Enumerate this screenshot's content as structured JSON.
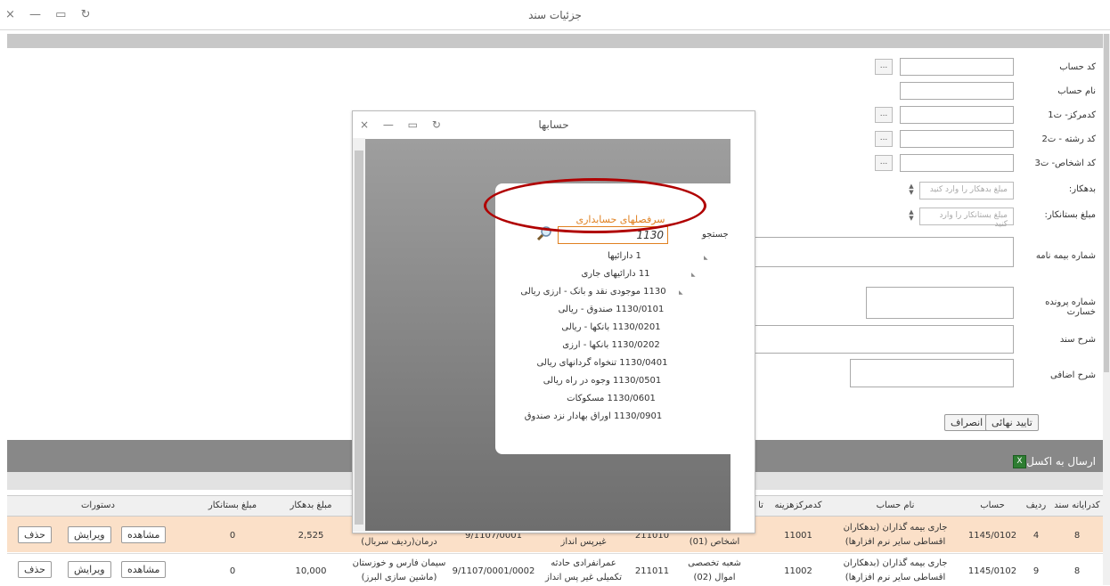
{
  "window": {
    "title": "جزئیات سند",
    "controls": "× — ▭ ↻"
  },
  "form": {
    "account_code": "کد حساب",
    "account_name": "نام حساب",
    "center_code": "کدمرکز- ت1",
    "field_code": "کد رشته - ت2",
    "person_code": "کد اشخاص- ت3",
    "debit": "بدهکار:",
    "debit_placeholder": "مبلغ بدهکار را وارد کنید",
    "credit": "مبلغ بستانکار:",
    "credit_placeholder": "مبلغ بستانکار را وارد کنید",
    "policy_no": "شماره بیمه نامه",
    "claim_no": "شماره پرونده خسارت",
    "doc_desc": "شرح سند",
    "extra_desc": "شرح اضافی",
    "dots": "...",
    "confirm": "تایید نهائی",
    "cancel": "انصراف"
  },
  "excel_export": "ارسال به اکسل",
  "grid": {
    "headers": [
      "کدرایانه سند",
      "ردیف",
      "حساب",
      "نام حساب",
      "کدمرکزهزینه",
      "تا",
      "مبلغ بدهکار",
      "مبلغ بستانکار",
      "دستورات"
    ],
    "rows": [
      {
        "doc": "8",
        "row": "4",
        "account": "1145/0102",
        "name1": "جاری بیمه گذاران (بدهکاران",
        "name2": "اقساطی سایر نرم افزارها)",
        "center": "11001",
        "c5a": "",
        "c5b": "اشخاص (01)",
        "c6": "211010",
        "c7a": "",
        "c7b": "غیرپس انداز",
        "c8": "9/1107/0001",
        "c9a": "",
        "c9b": "درمان(ردیف سربال)",
        "debit": "2,525",
        "credit": "0"
      },
      {
        "doc": "8",
        "row": "9",
        "account": "1145/0102",
        "name1": "جاری بیمه گذاران (بدهکاران",
        "name2": "اقساطی سایر نرم افزارها)",
        "center": "11002",
        "c5a": "شعبه تخصصی",
        "c5b": "اموال (02)",
        "c6": "211011",
        "c7a": "عمرانفرادی حادثه",
        "c7b": "تکمیلی غیر پس انداز",
        "c8": "9/1107/0001/0002",
        "c9a": "سیمان فارس و خوزستان",
        "c9b": "(ماشین سازی البرز)",
        "debit": "10,000",
        "credit": "0"
      }
    ],
    "actions": {
      "view": "مشاهده",
      "edit": "ویرایش",
      "delete": "حذف"
    }
  },
  "modal": {
    "title": "حسابها",
    "panel_title": "سرفصلهای حسابداری",
    "search_label": "جستجو",
    "search_value": "1130",
    "tree": [
      "1 دارائیها",
      "11 دارائیهای جاری",
      "1130 موجودی نقد و بانک - ارزی ریالی",
      "1130/0101 صندوق - ریالی",
      "1130/0201 بانکها - ریالی",
      "1130/0202 بانکها - ارزی",
      "1130/0401 تنخواه گردانهای ریالی",
      "1130/0501 وجوه در راه ریالی",
      "1130/0601 مسکوکات",
      "1130/0901 اوراق بهادار نزد صندوق"
    ]
  },
  "colors": {
    "highlight_row": "#fbe0c8",
    "annotation": "#b00000",
    "panel_title": "#e08020"
  }
}
